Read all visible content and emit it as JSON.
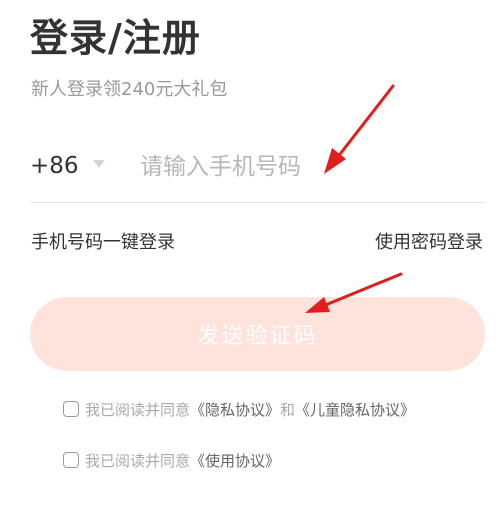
{
  "header": {
    "title": "登录/注册",
    "subtitle": "新人登录领240元大礼包"
  },
  "phone": {
    "country_code": "+86",
    "placeholder": "请输入手机号码",
    "value": ""
  },
  "links": {
    "one_click_login": "手机号码一键登录",
    "password_login": "使用密码登录"
  },
  "send_button": {
    "label": "发送验证码"
  },
  "agreements": {
    "row1": {
      "prefix": "我已阅读并同意",
      "privacy_policy": "《隐私协议》",
      "conjunction": "和",
      "child_privacy_policy": "《儿童隐私协议》",
      "checked": false
    },
    "row2": {
      "prefix": "我已阅读并同意",
      "usage_policy": "《使用协议》",
      "checked": false
    }
  },
  "icons": {
    "dropdown": "triangle-down-icon",
    "checkbox": "checkbox-icon",
    "annotation": "red-arrow-icon"
  },
  "colors": {
    "button_background": "#fde3db",
    "button_text": "#ffffff",
    "annotation_arrow": "#e01e1e",
    "placeholder": "#b7b7b7"
  }
}
